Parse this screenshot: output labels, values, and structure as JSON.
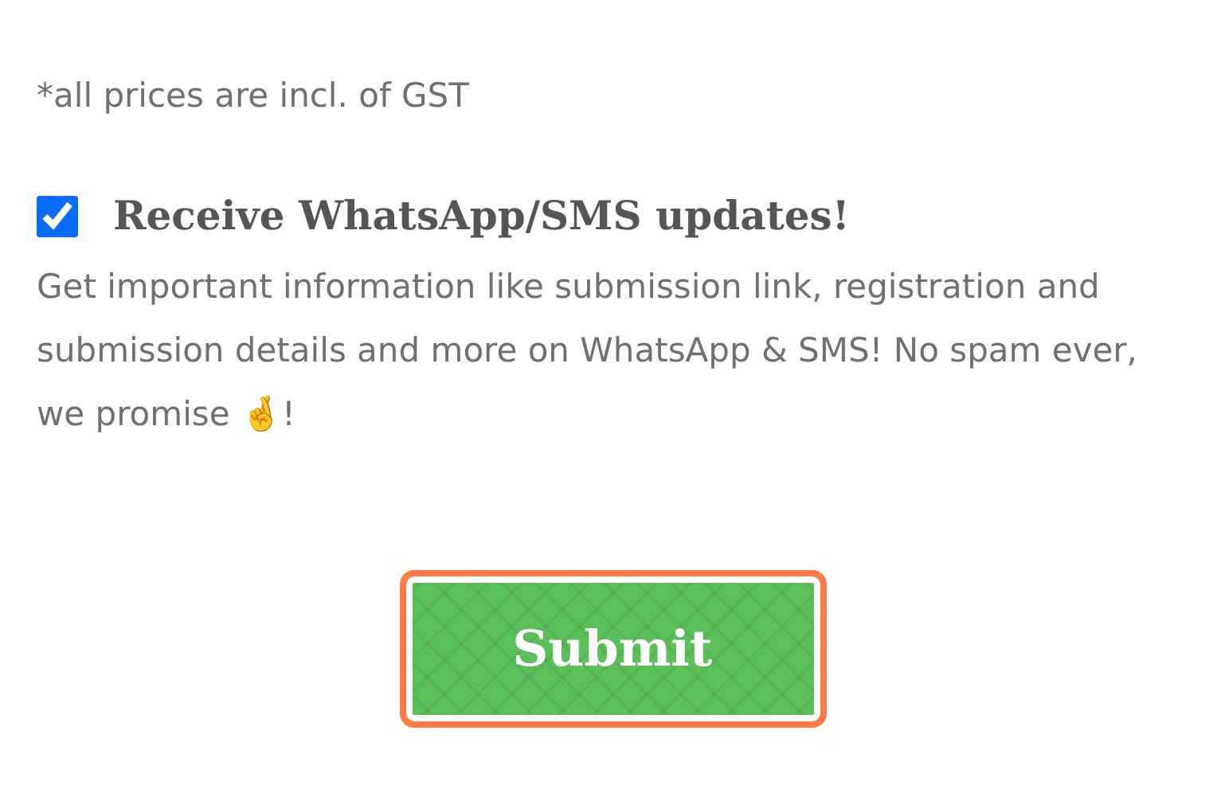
{
  "price_note": "*all prices are incl. of GST",
  "updates": {
    "checked": true,
    "label": "Receive WhatsApp/SMS updates!",
    "description": "Get important information like submission link, registration and submission details and more on WhatsApp & SMS! No spam ever, we promise 🤞!"
  },
  "submit_button": {
    "label": "Submit"
  }
}
